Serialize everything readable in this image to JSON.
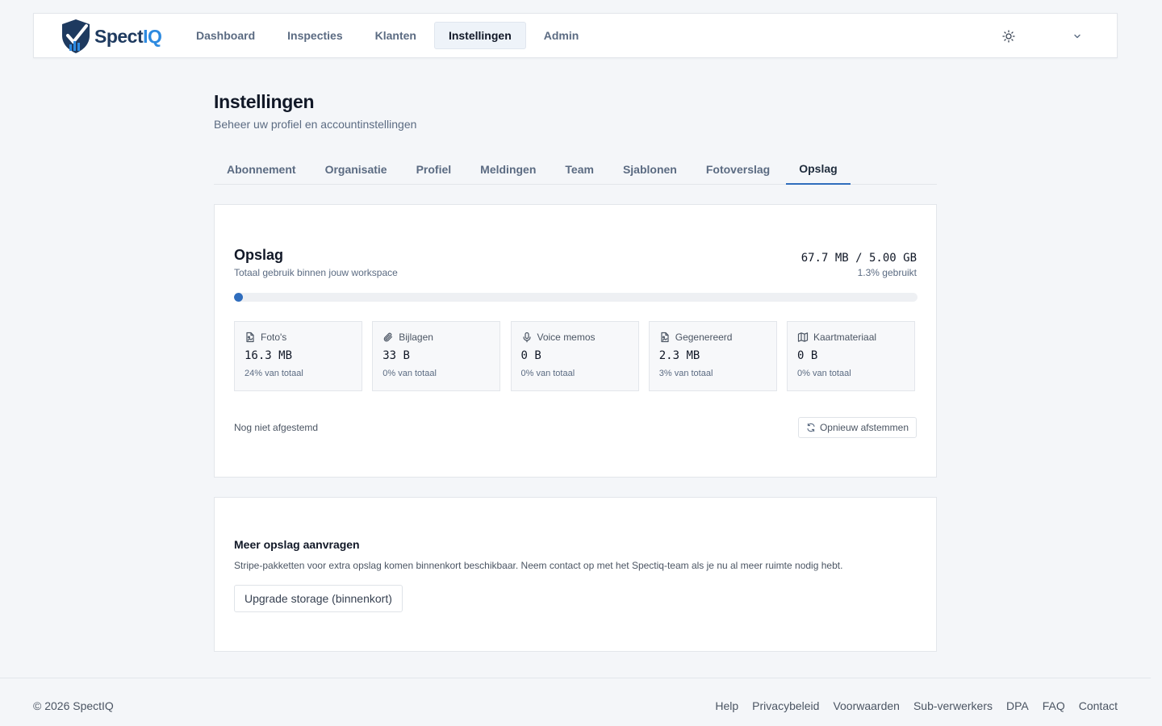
{
  "header": {
    "logo": {
      "text_main": "Spect",
      "text_accent": "IQ"
    },
    "nav": [
      {
        "label": "Dashboard",
        "active": false
      },
      {
        "label": "Inspecties",
        "active": false
      },
      {
        "label": "Klanten",
        "active": false
      },
      {
        "label": "Instellingen",
        "active": true
      },
      {
        "label": "Admin",
        "active": false
      }
    ],
    "theme_icon": "sun-icon",
    "user_menu_icon": "chevron-down-icon"
  },
  "page": {
    "title": "Instellingen",
    "subtitle": "Beheer uw profiel en accountinstellingen"
  },
  "tabs": [
    {
      "label": "Abonnement",
      "active": false
    },
    {
      "label": "Organisatie",
      "active": false
    },
    {
      "label": "Profiel",
      "active": false
    },
    {
      "label": "Meldingen",
      "active": false
    },
    {
      "label": "Team",
      "active": false
    },
    {
      "label": "Sjablonen",
      "active": false
    },
    {
      "label": "Fotoverslag",
      "active": false
    },
    {
      "label": "Opslag",
      "active": true
    }
  ],
  "storage": {
    "title": "Opslag",
    "subtitle": "Totaal gebruik binnen jouw workspace",
    "usage": "67.7 MB / 5.00 GB",
    "percent_label": "1.3% gebruikt",
    "used_percent": 1.3,
    "categories": [
      {
        "icon": "file-image-icon",
        "label": "Foto's",
        "value": "16.3 MB",
        "share": "24% van totaal"
      },
      {
        "icon": "paperclip-icon",
        "label": "Bijlagen",
        "value": "33 B",
        "share": "0% van totaal"
      },
      {
        "icon": "microphone-icon",
        "label": "Voice memos",
        "value": "0 B",
        "share": "0% van totaal"
      },
      {
        "icon": "file-image-icon",
        "label": "Gegenereerd",
        "value": "2.3 MB",
        "share": "3% van totaal"
      },
      {
        "icon": "map-icon",
        "label": "Kaartmateriaal",
        "value": "0 B",
        "share": "0% van totaal"
      }
    ],
    "sync_status": "Nog niet afgestemd",
    "sync_button": "Opnieuw afstemmen"
  },
  "upgrade": {
    "title": "Meer opslag aanvragen",
    "description": "Stripe-pakketten voor extra opslag komen binnenkort beschikbaar. Neem contact op met het Spectiq-team als je nu al meer ruimte nodig hebt.",
    "button": "Upgrade storage (binnenkort)"
  },
  "footer": {
    "copyright": "© 2026 SpectIQ",
    "links": [
      "Help",
      "Privacybeleid",
      "Voorwaarden",
      "Sub-verwerkers",
      "DPA",
      "FAQ",
      "Contact"
    ]
  },
  "colors": {
    "accent": "#2f6dbd",
    "logo_dark": "#1e3a5f",
    "logo_light": "#2d8ae0",
    "background": "#f4f6f9"
  }
}
